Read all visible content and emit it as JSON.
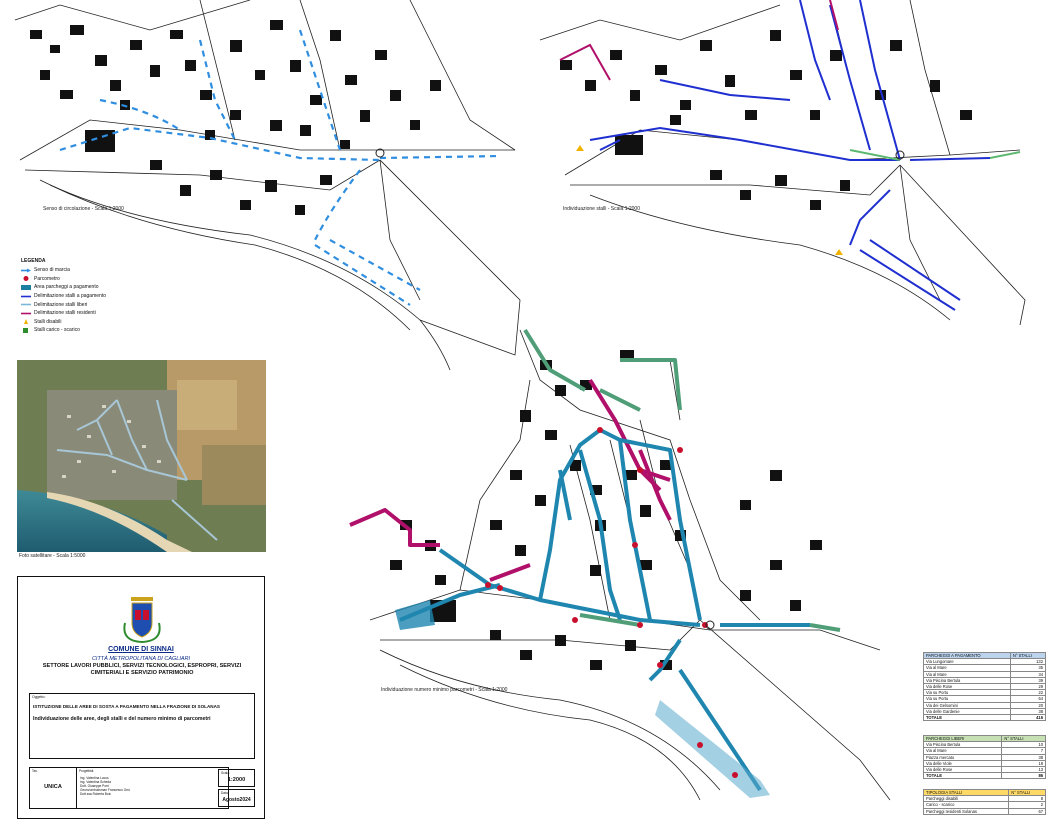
{
  "maps": [
    {
      "caption": "Senso di circolazione - Scala 1:2000"
    },
    {
      "caption": "Individuazione stalli - Scala 1:2000"
    },
    {
      "caption": "Individuazione numero minimo parcometri - Scala 1:2000"
    }
  ],
  "legend": {
    "title": "LEGENDA",
    "items": [
      {
        "label": "Senso di marcia",
        "icon": "arrow-icon",
        "color": "#2f8ee0"
      },
      {
        "label": "Parcometro",
        "icon": "parking-meter-icon",
        "color": "#c8102e"
      },
      {
        "label": "Area parcheggi a pagamento",
        "icon": "area-icon",
        "color": "#1a7fa0"
      },
      {
        "label": "Delimitazione stalli a pagamento",
        "icon": "line-icon",
        "color": "#1f2fd0"
      },
      {
        "label": "Delimitazione stalli liberi",
        "icon": "line-icon",
        "color": "#7ab8d8"
      },
      {
        "label": "Delimitazione stalli residenti",
        "icon": "line-icon",
        "color": "#b0106a"
      },
      {
        "label": "Stalli disabili",
        "icon": "disabled-icon",
        "color": "#f0b400"
      },
      {
        "label": "Stalli carico - scarico",
        "icon": "loading-icon",
        "color": "#2e8b2e"
      }
    ]
  },
  "satellite": {
    "caption": "Foto satellitare - Scala 1:5000"
  },
  "title_block": {
    "comune": "COMUNE DI SINNAI",
    "citta": "CITTÀ METROPOLITANA DI CAGLIARI",
    "settore_line1": "SETTORE LAVORI PUBBLICI, SERVIZI TECNOLOGICI, ESPROPRI, SERVIZI",
    "settore_line2": "CIMITERIALI E SERVIZIO PATRIMONIO",
    "oggetto_label": "Oggetto:",
    "oggetto_title": "ISTITUZIONE DELLE AREE DI SOSTA A PAGAMENTO NELLA FRAZIONE DI SOLANAS",
    "oggetto_subtitle": "Individuazione delle aree, degli stalli e del numero minimo di parcometri",
    "tav_label": "Tav.",
    "tav_value": "UNICA",
    "progettisti_label": "Progettisti:",
    "progettisti": [
      "Ing. Valentina Locus",
      "Ing. Valentina Scheda",
      "Dott. Giuseppe Porri",
      "Geom/ombudsman Francesco Orrù",
      "Dott.ssa Roberta Boic"
    ],
    "scala_label": "Scala:",
    "scala_value": "1:2000",
    "data_label": "Data:",
    "data_value": "Agosto2024"
  },
  "tables": {
    "pagamento": {
      "header": [
        "PARCHEGGI A PAGAMENTO",
        "N° STALLI"
      ],
      "header_color": "#bcd3ee",
      "rows": [
        [
          "Via Lungomare",
          "132"
        ],
        [
          "Via al Mare",
          "35"
        ],
        [
          "Via al Mare",
          "34"
        ],
        [
          "Via Piscina Bertula",
          "39"
        ],
        [
          "Via delle Rose",
          "29"
        ],
        [
          "Via su Portu",
          "22"
        ],
        [
          "Via su Portu",
          "64"
        ],
        [
          "Via dei Gelsomini",
          "20"
        ],
        [
          "Via delle Gardenie",
          "38"
        ]
      ],
      "total": [
        "TOTALE",
        "416"
      ]
    },
    "liberi": {
      "header": [
        "PARCHEGGI LIBERI",
        "N° STALLI"
      ],
      "header_color": "#c6e0b4",
      "rows": [
        [
          "Via Piscina Bertula",
          "10"
        ],
        [
          "Via al Mare",
          "7"
        ],
        [
          "Piazza mercato",
          "38"
        ],
        [
          "Via delle Viole",
          "18"
        ],
        [
          "Via delle Rose",
          "13"
        ]
      ],
      "total": [
        "TOTALE",
        "86"
      ]
    },
    "tipologia": {
      "header": [
        "TIPOLOGIA STALLI",
        "N° STALLI"
      ],
      "header_color": "#ffd966",
      "rows": [
        [
          "Parcheggi disabili",
          "8"
        ],
        [
          "Carico - scarico",
          "2"
        ],
        [
          "Parcheggi residenti Solanas",
          "67"
        ]
      ]
    }
  }
}
